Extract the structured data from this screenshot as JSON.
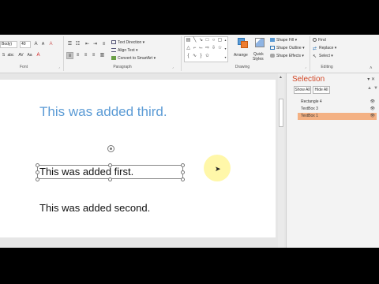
{
  "ribbon": {
    "font": {
      "name_value": "Body)",
      "size_value": "40",
      "group_label": "Font"
    },
    "paragraph": {
      "text_direction": "Text Direction",
      "align_text": "Align Text",
      "convert_smartart": "Convert to SmartArt",
      "group_label": "Paragraph"
    },
    "drawing": {
      "arrange": "Arrange",
      "quick_styles_line1": "Quick",
      "quick_styles_line2": "Styles",
      "shape_fill": "Shape Fill",
      "shape_outline": "Shape Outline",
      "shape_effects": "Shape Effects",
      "group_label": "Drawing"
    },
    "editing": {
      "find": "Find",
      "replace": "Replace",
      "select": "Select",
      "group_label": "Editing"
    }
  },
  "slide": {
    "text_third": "This was added third.",
    "text_first": "This was added first.",
    "text_second": "This was added second."
  },
  "selection_pane": {
    "title": "Selection",
    "show_all": "Show All",
    "hide_all": "Hide All",
    "objects": [
      {
        "name": "Rectangle 4",
        "selected": false
      },
      {
        "name": "TextBox 3",
        "selected": false
      },
      {
        "name": "TextBox 1",
        "selected": true
      }
    ]
  },
  "colors": {
    "accent_title": "#5b9bd5",
    "pane_title": "#d24726",
    "selected_row": "#f4b183",
    "cursor_highlight": "#fff48c"
  }
}
